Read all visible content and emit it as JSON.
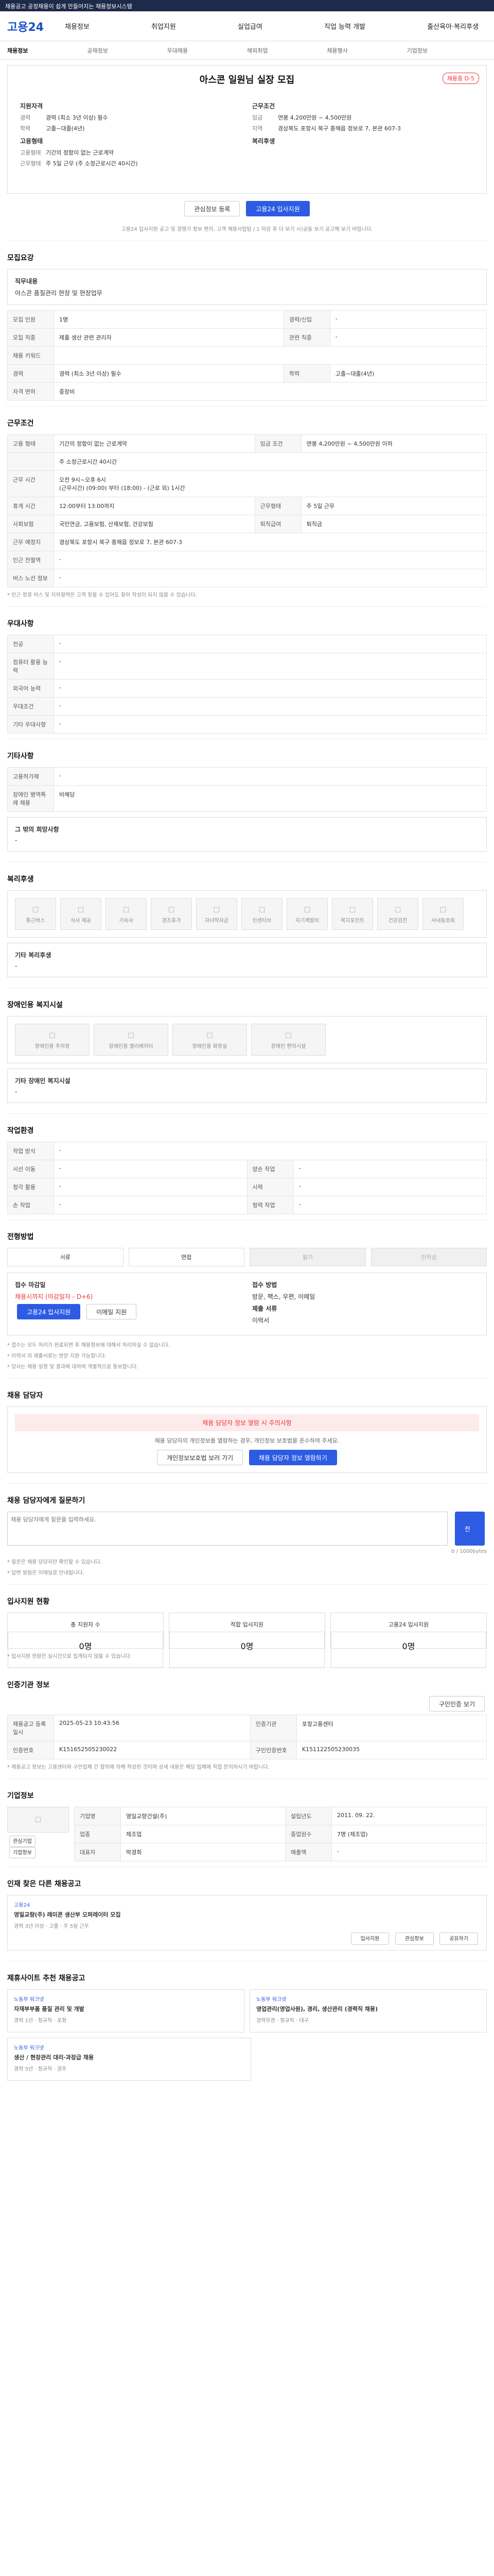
{
  "topbar": "채용공고 공정채용이 쉽게 만들어지는 채용정보시스템",
  "logo": "고용24",
  "nav": [
    "채용정보",
    "취업지원",
    "실업급여",
    "직업 능력 개발",
    "출산육아·복리후생"
  ],
  "subnav": [
    "채용정보",
    "공채정보",
    "우대채용",
    "해외취업",
    "채용행사",
    "기업정보"
  ],
  "job": {
    "company": "",
    "title": "아스콘 일원님 실장 모집",
    "badge": "채용중 D-5",
    "left_label": "지원자격",
    "right_label": "근무조건",
    "rows_left": [
      [
        "경력",
        "경력 (최소 3년 이상) 필수"
      ],
      [
        "학력",
        "고졸~대졸(4년)"
      ]
    ],
    "rows_right": [
      [
        "임금",
        "연봉 4,200만원 ~ 4,500만원"
      ],
      [
        "지역",
        "경상북도 포항시 북구 흥해읍 정보로 7, 본관 607-3"
      ]
    ],
    "rows_left2": [
      [
        "고용형태",
        "기간의 정함이 없는 근로계약"
      ],
      [
        "근무형태",
        "주 5일 근무 (주 소정근로시간 40시간)"
      ]
    ],
    "right_label2": "복리후생"
  },
  "cta": {
    "save": "관심정보 등록",
    "apply": "고용24 입사지원"
  },
  "cta_note": "고용24 입사지원 공고 및 경쟁기 정보 편의, 고객 채용사업팀 / 1 마감 후 더 보기 시)공동 보기 공고해 보기 바랍니다.",
  "s1": {
    "title": "모집요강",
    "desc_label": "직무내용",
    "desc": "아스콘 품질관리 현장 및 현장업무",
    "rows": [
      [
        "모집 인원",
        "1명",
        "경력/신입",
        "-"
      ],
      [
        "모집 직종",
        "제품 생산 관련 관리자",
        "관련 직종",
        "-"
      ],
      [
        "채용 키워드",
        "",
        "",
        ""
      ],
      [
        "경력",
        "경력 (최소 3년 이상) 필수",
        "학력",
        "고졸~대졸(4년)"
      ],
      [
        "자격 면허",
        "중장비",
        "",
        ""
      ]
    ]
  },
  "s2": {
    "title": "근무조건",
    "rows": [
      [
        "고용 형태",
        "기간의 정함이 없는 근로계약",
        "임금 조건",
        "연봉 4,200만원 ~ 4,500만원 이하"
      ],
      [
        "",
        "주 소정근로시간 40시간",
        "",
        ""
      ],
      [
        "근무 시간",
        "오전 9시~오후 6시",
        "",
        ""
      ],
      [
        "",
        "(근무시간) (09:00) 부터 (18:00) - (근로 외) 1시간",
        "",
        ""
      ],
      [
        "휴게 시간",
        "12:00부터 13:00까지",
        "근무형태",
        "주 5일 근무"
      ],
      [
        "사회보험",
        "국민연금, 고용보험, 산재보험, 건강보험",
        "퇴직급여",
        "퇴직금"
      ],
      [
        "근무 예정지",
        "경상북도 포항시 북구 흥해읍 정보로 7, 본관 607-3",
        "",
        ""
      ],
      [
        "인근 전철역",
        "-",
        "",
        ""
      ],
      [
        "버스 노선 정보",
        "-",
        "",
        ""
      ]
    ],
    "note": "* 인근 정류 버스 및 지하철역은 고객 찾을 수 있어도 찾아 작성이 되지 않을 수 있습니다."
  },
  "s3": {
    "title": "우대사항",
    "rows": [
      [
        "전공",
        "-"
      ],
      [
        "컴퓨터 활용 능력",
        "-"
      ],
      [
        "외국어 능력",
        "-"
      ],
      [
        "우대조건",
        "-"
      ],
      [
        "기타 우대사항",
        "-"
      ]
    ]
  },
  "s4": {
    "title": "기타사항",
    "rows": [
      [
        "고용허가제",
        "-"
      ],
      [
        "장애인 병역특례 채용",
        "비해당"
      ]
    ],
    "extra_label": "그 밖의 희망사항",
    "extra": "-"
  },
  "s5": {
    "title": "복리후생",
    "icons": [
      "통근버스",
      "식사 제공",
      "기숙사",
      "경조휴가",
      "자녀학자금",
      "인센티브",
      "자기계발비",
      "복지포인트",
      "건강검진",
      "사내동호회"
    ],
    "etc_label": "기타 복리후생",
    "etc": "-"
  },
  "s6": {
    "title": "장애인용 복지시설",
    "icons": [
      "장애인용 주차장",
      "장애인용 엘리베이터",
      "장애인용 화장실",
      "장애인 편의시설"
    ],
    "etc_label": "기타 장애인 복지시설",
    "etc": "-"
  },
  "s7": {
    "title": "작업환경",
    "rows": [
      [
        "작업 방식",
        "-",
        "",
        ""
      ],
      [
        "시선 이동",
        "-",
        "양손 작업",
        "-"
      ],
      [
        "청각 활용",
        "-",
        "시력",
        "-"
      ],
      [
        "손 작업",
        "-",
        "청력 작업",
        "-"
      ]
    ]
  },
  "s8": {
    "title": "전형방법",
    "steps": [
      "서류",
      "면접",
      "필기",
      "인적성"
    ],
    "apply_label": "접수 마감일",
    "apply_date": "채용시까지 (마감일자 - D+6)",
    "method_label": "접수 방법",
    "method": "방문, 팩스, 우편, 이메일",
    "btn1": "고용24 입사지원",
    "btn2": "이메일 지원",
    "doc_label": "제출 서류",
    "doc": "이력서",
    "notes": [
      "* 접수는 모두 처리가 완료되면 후 채용정보에 대해서 처리하실 수 없습니다.",
      "* 이력서 외 제출서류는 방문 지원 가능합니다.",
      "* 당사는 채용 일정 및 결과에 대하여 개별적으로 통보합니다."
    ]
  },
  "s9": {
    "title": "채용 담당자",
    "warn": "채용 담당자 정보 열람 시 주의사항",
    "warn_desc": "채용 담당자의 개인정보를 열람하는 경우, 개인정보 보호법을 준수하여 주세요.",
    "btn1": "개인정보보호법 보러 가기",
    "btn2": "채용 담당자 정보 열람하기"
  },
  "s10": {
    "title": "채용 담당자에게 질문하기",
    "placeholder": "채용 담당자에게 질문을 입력하세요.",
    "btn": "전송",
    "count": "0 / 1000bytes",
    "notes": [
      "* 질문은 채용 담당자만 확인할 수 있습니다.",
      "* 답변 알림은 이메일로 안내됩니다."
    ]
  },
  "s11": {
    "title": "입사지원 현황",
    "items": [
      [
        "총 지원자 수",
        "0명"
      ],
      [
        "적합 입사지원",
        "0명"
      ],
      [
        "고용24 입사지원",
        "0명"
      ]
    ],
    "note": "* 입사지원 현황은 실시간으로 집계되지 않을 수 있습니다."
  },
  "s12": {
    "title": "인증기관 정보",
    "btn": "구인인증 보기",
    "rows": [
      [
        "채용공고 등록일시",
        "2025-05-23 10:43:56",
        "인증기관",
        "포항고용센터"
      ],
      [
        "인증번호",
        "K151652505230022",
        "구인인증번호",
        "K151122505230035"
      ]
    ],
    "note": "* 채용공고 정보는 고용센터와 구인업체 간 합의에 의해 작성된 것이며 상세 내용은 해당 업체에 직접 문의하시기 바랍니다."
  },
  "s13": {
    "title": "기업정보",
    "more": "더보기",
    "btn1": "관심기업",
    "btn2": "기업정보",
    "rows": [
      [
        "기업명",
        "영일교량건설(주)",
        "설립년도",
        "2011. 09. 22."
      ],
      [
        "업종",
        "제조업",
        "종업원수",
        "7명 (제조업)"
      ],
      [
        "대표자",
        "박경희",
        "매출액",
        "-"
      ]
    ]
  },
  "s14": {
    "title": "인재 찾은 다른 채용공고",
    "card_tag": "고용24",
    "card_title": "영일교량(주) 레미콘 생산부 오퍼레이터 모집",
    "card_info": "경력 3년 이상 · 고졸 · 주 5일 근무",
    "btns": [
      "입사지원",
      "관심정보",
      "공유하기"
    ]
  },
  "s15": {
    "title": "제휴사이트 추천 채용공고",
    "cards": [
      [
        "노동부 워크넷",
        "자재부부품 품질 관리 및 개발",
        "경력 1년 · 정규직 · 포항"
      ],
      [
        "노동부 워크넷",
        "영업관리(영업사원), 경리, 생산관리 (경력직 채용)",
        "경력무관 · 정규직 · 대구"
      ],
      [
        "노동부 워크넷",
        "생산 / 현장관리 대리·과장급 채용",
        "경력 5년 · 정규직 · 경주"
      ]
    ]
  }
}
